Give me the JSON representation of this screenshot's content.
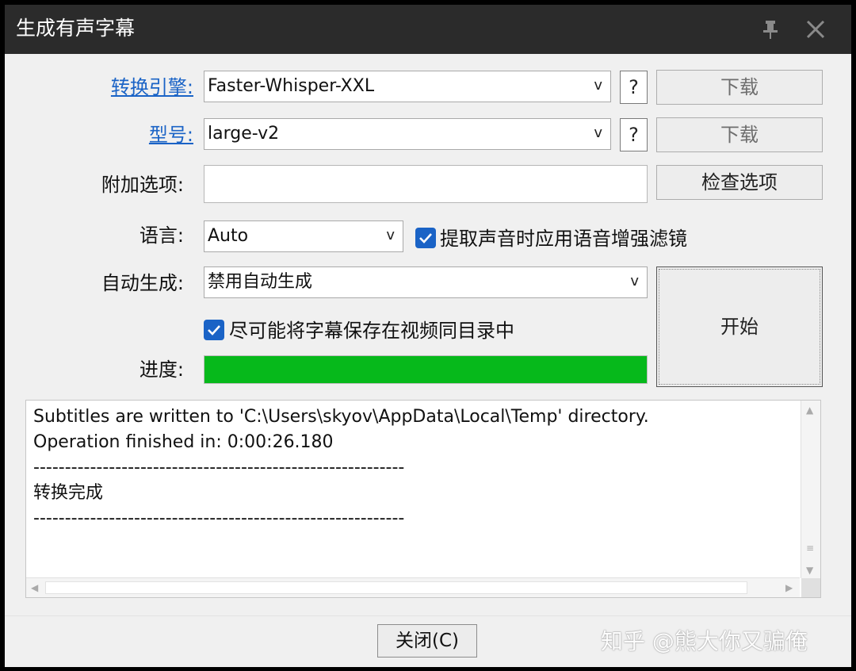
{
  "window": {
    "title": "生成有声字幕"
  },
  "titlebar": {
    "pin_icon": "pin-icon",
    "close_icon": "close-icon"
  },
  "form": {
    "engine": {
      "label": "转换引擎:",
      "value": "Faster-Whisper-XXL",
      "help": "?",
      "download": "下载"
    },
    "model": {
      "label": "型号:",
      "value": "large-v2",
      "help": "?",
      "download": "下载"
    },
    "extra": {
      "label": "附加选项:",
      "value": "",
      "check_button": "检查选项"
    },
    "language": {
      "label": "语言:",
      "value": "Auto"
    },
    "voice_filter": {
      "checked": true,
      "label": "提取声音时应用语音增强滤镜"
    },
    "auto_generate": {
      "label": "自动生成:",
      "value": "禁用自动生成"
    },
    "save_same_dir": {
      "checked": true,
      "label": "尽可能将字幕保存在视频同目录中"
    },
    "progress": {
      "label": "进度:",
      "percent": 100
    },
    "start_button": "开始",
    "combo_arrow": "v"
  },
  "log": {
    "lines": [
      "Subtitles are written to 'C:\\Users\\skyov\\AppData\\Local\\Temp' directory.",
      "Operation finished in: 0:00:26.180",
      "-----------------------------------------------------------",
      "转换完成",
      "-----------------------------------------------------------"
    ]
  },
  "footer": {
    "close_button": "关闭(C)"
  },
  "watermark": "知乎 @熊大你又骗俺",
  "colors": {
    "accent": "#1a63c6",
    "progress": "#06b91b",
    "titlebar": "#2b2b2b"
  }
}
